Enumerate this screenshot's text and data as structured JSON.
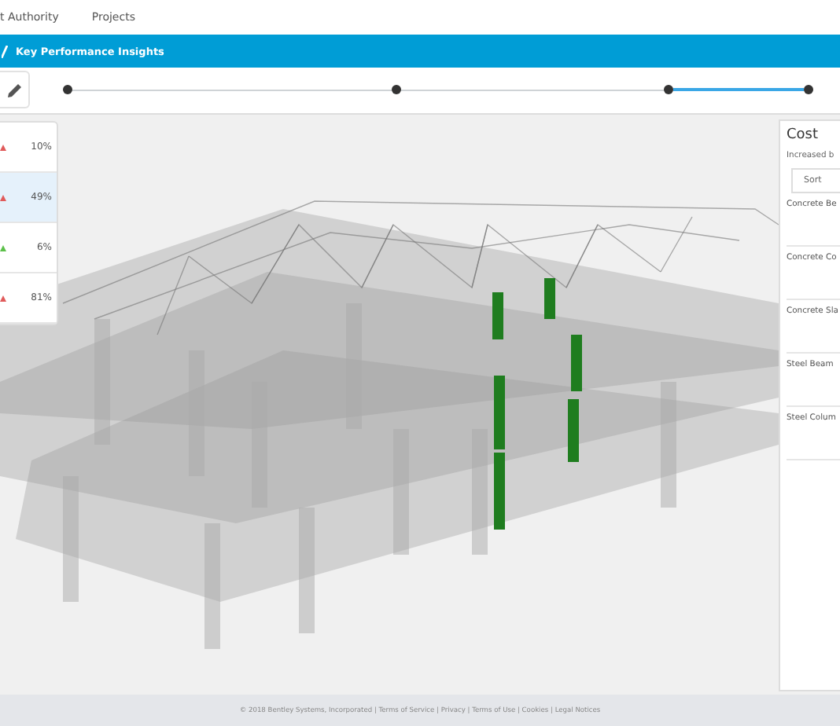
{
  "nav": {
    "items": [
      {
        "label": "t Authority"
      },
      {
        "label": "Projects"
      }
    ]
  },
  "header": {
    "title": "Key Performance Insights"
  },
  "timeline": {
    "segments": [
      {
        "active": false
      },
      {
        "active": false
      },
      {
        "active": true
      }
    ]
  },
  "kpi_panel": {
    "rows": [
      {
        "value": "10%",
        "color": "#e05a5a",
        "selected": false
      },
      {
        "value": "49%",
        "color": "#e05a5a",
        "selected": true
      },
      {
        "value": "6%",
        "color": "#5cc04a",
        "selected": false
      },
      {
        "value": "81%",
        "color": "#e05a5a",
        "selected": false
      }
    ]
  },
  "cost_panel": {
    "title": "Cost",
    "subtitle": "Increased b",
    "sort": {
      "label": "Sort"
    },
    "items": [
      {
        "label": "Concrete Be"
      },
      {
        "label": "Concrete Co"
      },
      {
        "label": "Concrete Sla"
      },
      {
        "label": "Steel Beam"
      },
      {
        "label": "Steel Colum"
      }
    ]
  },
  "footer": {
    "text": "© 2018 Bentley Systems, Incorporated | Terms of Service | Privacy | Terms of Use | Cookies | Legal Notices"
  }
}
